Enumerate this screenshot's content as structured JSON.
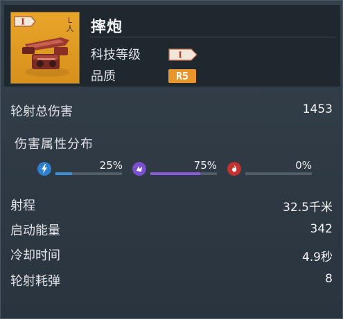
{
  "weapon": {
    "name": "摔炮",
    "thumb_tier": "I",
    "thumb_corner": "L\n人"
  },
  "info": {
    "tech_label": "科技等级",
    "tech_value": "I",
    "quality_label": "品质",
    "quality_value": "R5"
  },
  "stats": {
    "total_damage_label": "轮射总伤害",
    "total_damage_value": "1453",
    "distribution_title": "伤害属性分布",
    "damage_types": [
      {
        "icon": "lightning-icon",
        "percent_text": "25%",
        "value": 25,
        "color": "#3c8fd6"
      },
      {
        "icon": "explosive-icon",
        "percent_text": "75%",
        "value": 75,
        "color": "#8b5ad6"
      },
      {
        "icon": "fire-icon",
        "percent_text": "0%",
        "value": 0,
        "color": "#d04040"
      }
    ],
    "range_label": "射程",
    "range_value": "32.5千米",
    "energy_label": "启动能量",
    "energy_value": "342",
    "cooldown_label": "冷却时间",
    "cooldown_value": "4.9秒",
    "ammo_label": "轮射耗弹",
    "ammo_value": "8"
  }
}
